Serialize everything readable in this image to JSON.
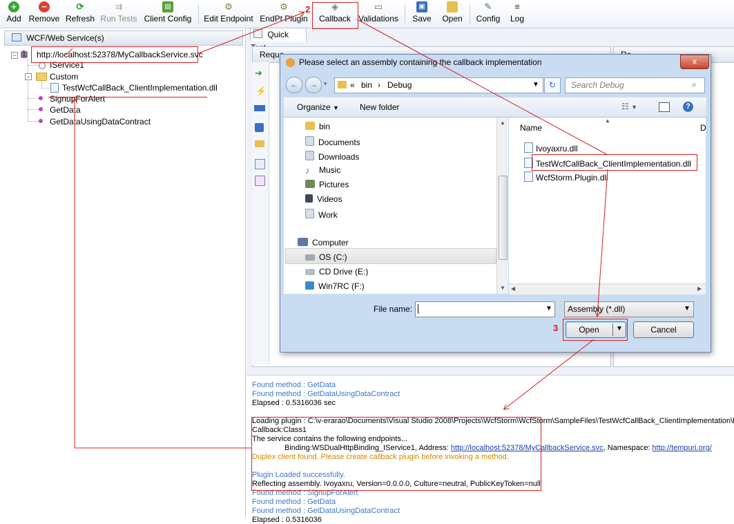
{
  "toolbar": {
    "add": "Add",
    "remove": "Remove",
    "refresh": "Refresh",
    "run_tests": "Run Tests",
    "client_config": "Client Config",
    "edit_endpoint": "Edit Endpoint",
    "endpt_plugin": "EndPt Plugin",
    "callback": "Callback",
    "validations": "Validations",
    "save": "Save",
    "open": "Open",
    "config": "Config",
    "log": "Log"
  },
  "left_panel": {
    "header": "WCF/Web Service(s)",
    "tree": {
      "root": "http://localhost:52378/MyCallbackService.svc",
      "iservice": "IService1",
      "custom": "Custom",
      "dll": "TestWcfCallBack_ClientImplementation.dll",
      "methods": [
        "SignupForAlert",
        "GetData",
        "GetDataUsingDataContract"
      ]
    }
  },
  "right": {
    "tab": "Quick Test",
    "request_label": "Reque",
    "response_label": "Re"
  },
  "dialog": {
    "title": "Please select an assembly containing the callback implementation",
    "close": "x",
    "address": {
      "prefix": "«",
      "parts": [
        "bin",
        "Debug"
      ],
      "sep": "›"
    },
    "search_placeholder": "Search Debug",
    "organize": "Organize",
    "new_folder": "New folder",
    "nav_items": [
      "bin",
      "Documents",
      "Downloads",
      "Music",
      "Pictures",
      "Videos",
      "Work",
      "Computer",
      "OS (C:)",
      "CD Drive (E:)",
      "Win7RC (F:)"
    ],
    "column_name": "Name",
    "column_d": "D",
    "files": [
      "Ivoyaxru.dll",
      "TestWcfCallBack_ClientImplementation.dll",
      "WcfStorm.Plugin.dll"
    ],
    "file_name_label": "File name:",
    "file_name_value": "",
    "filter": "Assembly (*.dll)",
    "open": "Open",
    "cancel": "Cancel"
  },
  "annotations": {
    "n1": "1",
    "n2": "2",
    "n3": "3"
  },
  "log": {
    "lines_top": [
      {
        "text": "Found method : GetData",
        "kind": "blue"
      },
      {
        "text": "Found method : GetDataUsingDataContract",
        "kind": "blue"
      },
      {
        "text": "Elapsed : 0.5316036 sec",
        "kind": "black"
      }
    ],
    "loading": "Loading plugin : C:\\v-erarao\\Documents\\Visual Studio 2008\\Projects\\WcfStorm\\WcfStorm\\SampleFiles\\TestWcfCallBack_ClientImplementation\\bin",
    "callback": "Callback:Class1",
    "endpoints": "The service contains the following endpoints...",
    "binding_prefix": "Binding:WSDualHttpBinding_IService1, Address: ",
    "binding_address": "http://localhost:52378/MyCallbackService.svc",
    "binding_ns_label": ", Namespace: ",
    "binding_ns": "http://tempuri.org/",
    "duplex": "Duplex client found. Please create callback plugin before invoking a method.",
    "plugin_loaded": "Plugin Loaded successfully.",
    "reflecting": "Reflecting assembly. Ivoyaxru, Version=0.0.0.0, Culture=neutral, PublicKeyToken=null",
    "lines_bottom": [
      "Found method : SignupForAlert",
      "Found method : GetData",
      "Found method : GetDataUsingDataContract"
    ],
    "elapsed_partial": "Elapsed : 0.5316036"
  },
  "colors": {
    "annotation_red": "#d42020",
    "log_blue": "#3a78c8",
    "log_orange": "#d08a00"
  }
}
